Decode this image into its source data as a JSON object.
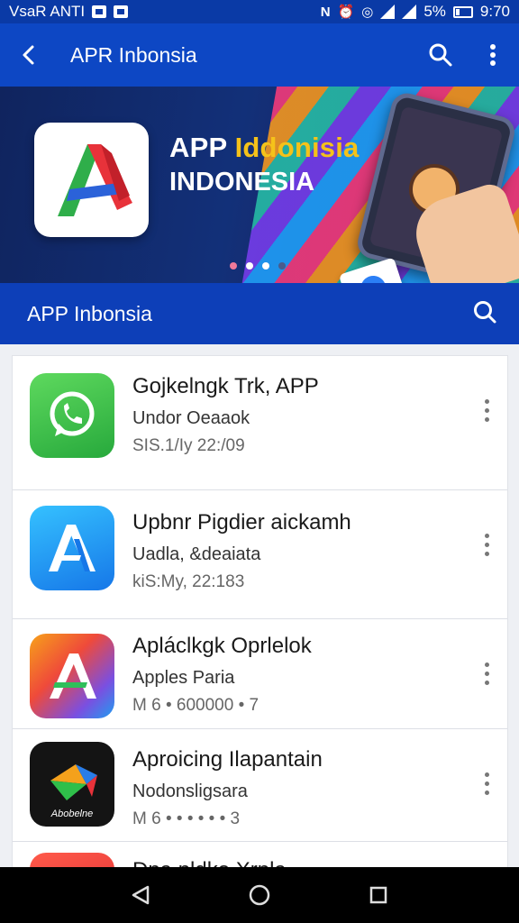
{
  "status_bar": {
    "carrier": "VsaR ANTI",
    "battery_percent": "5%",
    "time": "9:70"
  },
  "app_bar": {
    "title": "APR Inbonsia"
  },
  "banner": {
    "title_prefix": "APP",
    "title_highlight": "Iddonisia",
    "subtitle": "INDONESIA",
    "dots_total": 4,
    "dots_active": 1
  },
  "section": {
    "title": "APP Inbonsia"
  },
  "apps": [
    {
      "title": "Gojkelngk Trk, APP",
      "subtitle": "Undor Oeaaok",
      "meta": "SIS.1/Iy 22:/09",
      "icon": "whatsapp-icon",
      "color": "#3dbb4a"
    },
    {
      "title": "Upbnr Pigdier aickamh",
      "subtitle": "Uadla, &deaiata",
      "meta": "kiS:My, 22:183",
      "icon": "a-logo-icon",
      "color": "#1b9df0"
    },
    {
      "title": "Apláclkgk Oprlelok",
      "subtitle": "Apples Paria",
      "meta": "M 6 • 600000 • 7",
      "icon": "rainbow-a-icon",
      "color": "#f06a2a"
    },
    {
      "title": "Aproicing Ilapantain",
      "subtitle": "Nodonsligsara",
      "meta": "M 6 • • • • • • 3",
      "icon": "origami-icon",
      "color": "#111111",
      "icon_label": "Abobelne"
    },
    {
      "title": "Dpa pldko Xrpla",
      "subtitle": "",
      "meta": "",
      "icon": "red-app-icon",
      "color": "#e8323a"
    }
  ]
}
